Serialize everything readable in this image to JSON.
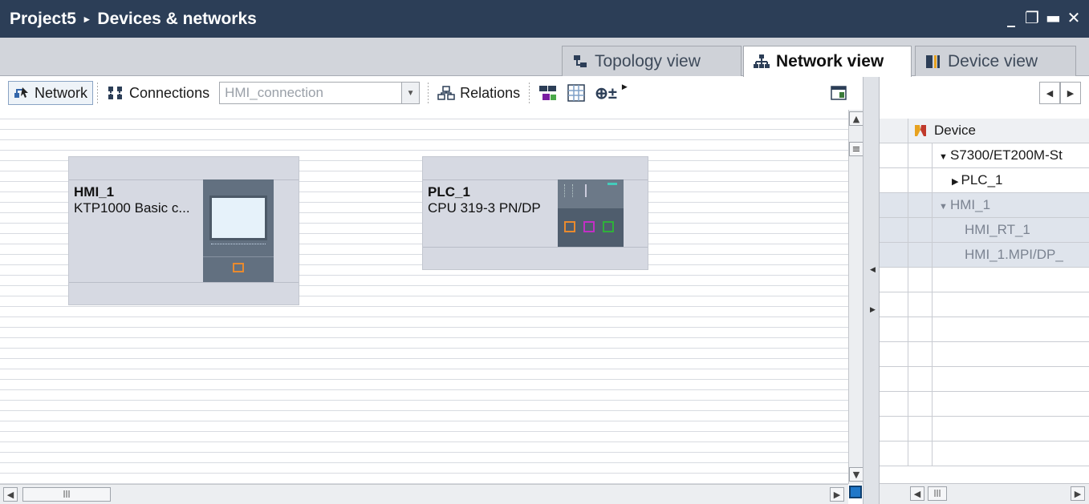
{
  "title": {
    "project": "Project5",
    "page": "Devices & networks",
    "separator": "▸",
    "window_controls": [
      "_",
      "❐",
      "▬",
      "✕"
    ]
  },
  "tabs": [
    {
      "label": "Topology view",
      "icon": "topology-icon",
      "active": false
    },
    {
      "label": "Network view",
      "icon": "network-icon",
      "active": true
    },
    {
      "label": "Device view",
      "icon": "device-view-icon",
      "active": false
    }
  ],
  "toolbar": {
    "network_label": "Network",
    "connections_label": "Connections",
    "connection_type_value": "HMI_connection",
    "relations_label": "Relations",
    "zoom_glyph": "⊕±"
  },
  "devices": [
    {
      "name": "HMI_1",
      "type": "KTP1000 Basic c..."
    },
    {
      "name": "PLC_1",
      "type": "CPU 319-3 PN/DP"
    }
  ],
  "overview": {
    "column_header": "Device",
    "rows": [
      {
        "label": "S7300/ET200M-St",
        "expander": "▼",
        "indent": 1,
        "highlight": false
      },
      {
        "label": "PLC_1",
        "expander": "▶",
        "indent": 2,
        "highlight": false
      },
      {
        "label": "HMI_1",
        "expander": "▼",
        "indent": 1,
        "highlight": true
      },
      {
        "label": "HMI_RT_1",
        "expander": "",
        "indent": 3,
        "highlight": true
      },
      {
        "label": "HMI_1.MPI/DP_",
        "expander": "",
        "indent": 3,
        "highlight": true
      }
    ]
  },
  "scrollbars": {
    "up": "▲",
    "down": "▼",
    "left": "◀",
    "right": "▶",
    "grip_v": "≡",
    "grip_h": "|||"
  }
}
